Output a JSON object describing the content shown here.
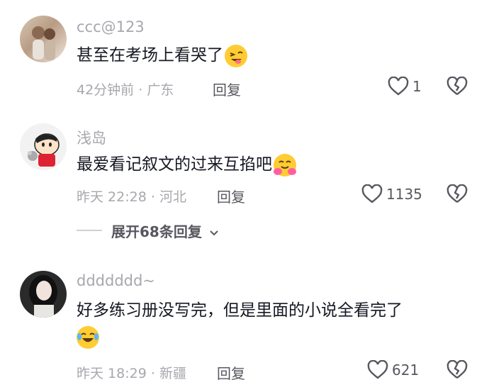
{
  "comments": [
    {
      "username": "ccc@123",
      "text": "甚至在考场上看哭了",
      "emoji": "grinning-squint-tongue-emoji",
      "time": "42分钟前",
      "region": "广东",
      "reply_label": "回复",
      "likes": "1"
    },
    {
      "username": "浅岛",
      "text": "最爱看记叙文的过来互掐吧",
      "emoji": "hugging-face-emoji",
      "time": "昨天 22:28",
      "region": "河北",
      "reply_label": "回复",
      "likes": "1135",
      "expand_label": "展开68条回复"
    },
    {
      "username": "ddddddd~",
      "text": "好多练习册没写完，但是里面的小说全看完了",
      "emoji": "laughing-tears-emoji",
      "time": "昨天 18:29",
      "region": "新疆",
      "reply_label": "回复",
      "likes": "621"
    }
  ],
  "separator": "·",
  "colors": {
    "meta": "#a7a7ad",
    "text": "#161823",
    "action": "#57575f"
  }
}
